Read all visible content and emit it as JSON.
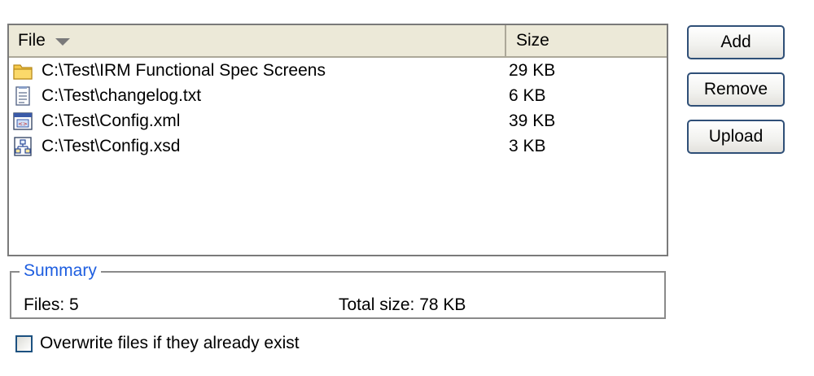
{
  "file_list": {
    "columns": {
      "file": "File",
      "size": "Size"
    },
    "rows": [
      {
        "icon": "folder-icon",
        "name": "C:\\Test\\IRM Functional Spec Screens",
        "size": "29 KB"
      },
      {
        "icon": "text-file-icon",
        "name": "C:\\Test\\changelog.txt",
        "size": "6 KB"
      },
      {
        "icon": "xml-file-icon",
        "name": "C:\\Test\\Config.xml",
        "size": "39 KB"
      },
      {
        "icon": "xsd-file-icon",
        "name": "C:\\Test\\Config.xsd",
        "size": "3 KB"
      }
    ]
  },
  "buttons": {
    "add": "Add",
    "remove": "Remove",
    "upload": "Upload"
  },
  "summary": {
    "legend": "Summary",
    "files": "Files: 5",
    "total_size": "Total size: 78 KB"
  },
  "overwrite": {
    "label": "Overwrite files if they already exist",
    "checked": false
  },
  "colors": {
    "header_bg": "#ece9d8",
    "button_border": "#2f4f77",
    "legend_text": "#1e5ee0",
    "folder_yellow": "#f5c84a"
  }
}
